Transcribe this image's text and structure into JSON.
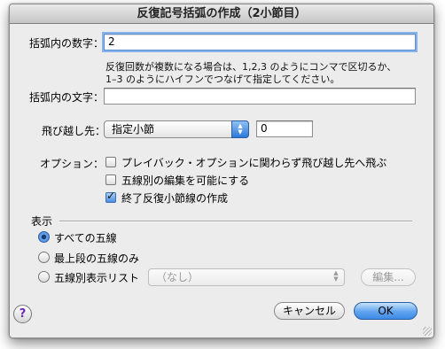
{
  "window": {
    "title": "反復記号括弧の作成（2小節目）"
  },
  "bracket_number": {
    "label": "括弧内の数字：",
    "value": "2"
  },
  "help_text": {
    "line1": "反復回数が複数になる場合は、1,2,3 のようにコンマで区切るか、",
    "line2": "1–3 のようにハイフンでつなげて指定してください。"
  },
  "bracket_text": {
    "label": "括弧内の文字：",
    "value": ""
  },
  "jump_to": {
    "label": "飛び越し先：",
    "selected": "指定小節",
    "measure": "0"
  },
  "options": {
    "label": "オプション：",
    "items": [
      {
        "label": "プレイバック・オプションに関わらず飛び越し先へ飛ぶ",
        "checked": false
      },
      {
        "label": "五線別の編集を可能にする",
        "checked": false
      },
      {
        "label": "終了反復小節線の作成",
        "checked": true
      }
    ]
  },
  "display": {
    "label": "表示",
    "radios": [
      {
        "label": "すべての五線",
        "selected": true
      },
      {
        "label": "最上段の五線のみ",
        "selected": false
      },
      {
        "label": "五線別表示リスト",
        "selected": false
      }
    ],
    "staff_list_selected": "（なし）",
    "edit_button": "編集..."
  },
  "buttons": {
    "help": "?",
    "cancel": "キャンセル",
    "ok": "OK"
  }
}
